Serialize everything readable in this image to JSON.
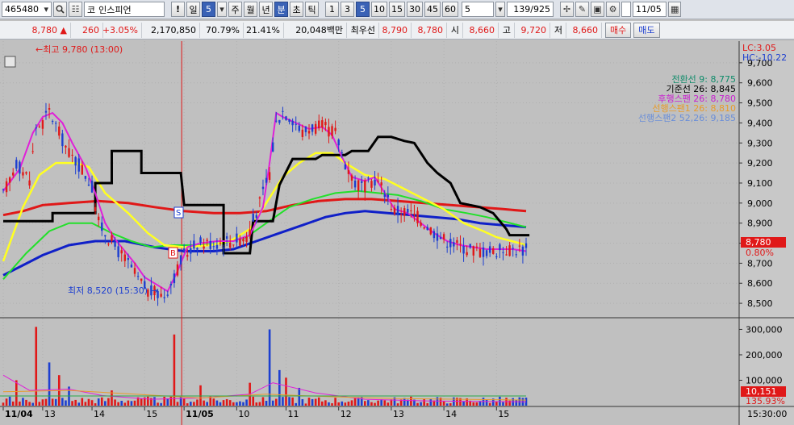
{
  "toolbar": {
    "code": "465480",
    "market_tag": "코",
    "stock_name": "인스피언",
    "period_buttons": [
      "일",
      "5",
      "주",
      "월",
      "년",
      "분",
      "초",
      "틱"
    ],
    "selected_period": "분",
    "minute_buttons": [
      "1",
      "3",
      "5",
      "10",
      "15",
      "30",
      "45",
      "60"
    ],
    "selected_minute": "5",
    "interval_value": "5",
    "count_display": "139/925",
    "date_value": "11/05"
  },
  "quote": {
    "price": "8,780",
    "change_arrow": "▲",
    "change": "260",
    "change_pct": "+3.05%",
    "volume": "2,170,850",
    "ratio1": "70.79%",
    "ratio2": "21.41%",
    "amount": "20,048백만",
    "best_label": "최우선",
    "best_ask": "8,790",
    "best_bid": "8,780",
    "open_label": "시",
    "open": "8,660",
    "high_label": "고",
    "high": "9,720",
    "low_label": "저",
    "low": "8,660",
    "buy_button": "매수",
    "sell_button": "매도"
  },
  "chart_labels": {
    "lc": "LC:3.05",
    "hc": "HC:-10.22",
    "high_note": "←최고 9,780 (13:00)",
    "low_note": "최저 8,520 (15:30) →",
    "signal_s": "S",
    "signal_b": "B",
    "current_price_tag": "8,780",
    "current_pct_tag": "0.80%",
    "volume_tag": "10,151",
    "volume_pct_tag": "135.93%",
    "time_tag": "15:30:00"
  },
  "colors": {
    "up": "#e01818",
    "down": "#1d3fd0",
    "background": "#c0c0c0"
  },
  "chart_data": [
    {
      "type": "line",
      "title": "",
      "y_ticks": [
        8500,
        8600,
        8700,
        8800,
        8900,
        9000,
        9100,
        9200,
        9300,
        9400,
        9500,
        9600,
        9700
      ],
      "ylim": [
        8440,
        9800
      ],
      "x_tick_labels": [
        "11/04",
        "13",
        "14",
        "15",
        "11/05",
        "10",
        "11",
        "12",
        "13",
        "14",
        "15"
      ],
      "x_tick_bar_index": [
        0,
        12,
        27,
        43,
        55,
        71,
        86,
        102,
        118,
        134,
        150
      ],
      "n_bars": 160,
      "series": [
        {
          "name": "전환선 9: 8,775",
          "color": "#0f8c6a"
        },
        {
          "name": "기준선 26: 8,845",
          "color": "#000000"
        },
        {
          "name": "후행스팬 26: 8,780",
          "color": "#c81ecf"
        },
        {
          "name": "선행스팬1 26: 8,810",
          "color": "#e89b2a"
        },
        {
          "name": "선행스팬2 52,26: 9,185",
          "color": "#6a8ed8"
        }
      ],
      "anchors": {
        "price": [
          [
            0,
            9040
          ],
          [
            4,
            9200
          ],
          [
            8,
            9120
          ],
          [
            10,
            9380
          ],
          [
            12,
            9400
          ],
          [
            14,
            9460
          ],
          [
            17,
            9350
          ],
          [
            20,
            9250
          ],
          [
            24,
            9170
          ],
          [
            27,
            9080
          ],
          [
            29,
            8900
          ],
          [
            32,
            8830
          ],
          [
            35,
            8760
          ],
          [
            38,
            8700
          ],
          [
            41,
            8620
          ],
          [
            44,
            8560
          ],
          [
            49,
            8540
          ],
          [
            51,
            8600
          ],
          [
            55,
            8740
          ],
          [
            59,
            8800
          ],
          [
            64,
            8800
          ],
          [
            69,
            8810
          ],
          [
            74,
            8830
          ],
          [
            78,
            9000
          ],
          [
            81,
            9150
          ],
          [
            83,
            9400
          ],
          [
            85,
            9460
          ],
          [
            88,
            9420
          ],
          [
            91,
            9350
          ],
          [
            94,
            9380
          ],
          [
            97,
            9380
          ],
          [
            101,
            9350
          ],
          [
            104,
            9200
          ],
          [
            107,
            9100
          ],
          [
            110,
            9080
          ],
          [
            113,
            9120
          ],
          [
            116,
            9060
          ],
          [
            119,
            8960
          ],
          [
            122,
            8960
          ],
          [
            126,
            8930
          ],
          [
            130,
            8870
          ],
          [
            134,
            8820
          ],
          [
            138,
            8790
          ],
          [
            142,
            8770
          ],
          [
            146,
            8760
          ],
          [
            150,
            8760
          ],
          [
            154,
            8770
          ],
          [
            159,
            8770
          ]
        ],
        "black": [
          [
            0,
            8910
          ],
          [
            15,
            8910
          ],
          [
            15,
            8950
          ],
          [
            28,
            8950
          ],
          [
            28,
            9100
          ],
          [
            33,
            9100
          ],
          [
            33,
            9260
          ],
          [
            42,
            9260
          ],
          [
            42,
            9150
          ],
          [
            54,
            9150
          ],
          [
            55,
            8990
          ],
          [
            67,
            8990
          ],
          [
            67,
            8750
          ],
          [
            75,
            8750
          ],
          [
            76,
            8910
          ],
          [
            82,
            8910
          ],
          [
            84,
            9090
          ],
          [
            88,
            9220
          ],
          [
            95,
            9220
          ],
          [
            97,
            9240
          ],
          [
            104,
            9240
          ],
          [
            106,
            9260
          ],
          [
            111,
            9260
          ],
          [
            114,
            9330
          ],
          [
            118,
            9330
          ],
          [
            122,
            9310
          ],
          [
            125,
            9300
          ],
          [
            129,
            9200
          ],
          [
            132,
            9150
          ],
          [
            136,
            9100
          ],
          [
            139,
            9000
          ],
          [
            145,
            8980
          ],
          [
            149,
            8950
          ],
          [
            153,
            8870
          ],
          [
            154,
            8840
          ],
          [
            160,
            8840
          ]
        ],
        "yellow": [
          [
            0,
            8710
          ],
          [
            6,
            8980
          ],
          [
            11,
            9140
          ],
          [
            16,
            9200
          ],
          [
            22,
            9200
          ],
          [
            26,
            9180
          ],
          [
            31,
            9050
          ],
          [
            38,
            8950
          ],
          [
            44,
            8850
          ],
          [
            49,
            8790
          ],
          [
            55,
            8780
          ],
          [
            63,
            8790
          ],
          [
            69,
            8810
          ],
          [
            75,
            8870
          ],
          [
            80,
            9000
          ],
          [
            85,
            9130
          ],
          [
            90,
            9200
          ],
          [
            95,
            9250
          ],
          [
            100,
            9250
          ],
          [
            104,
            9200
          ],
          [
            110,
            9140
          ],
          [
            116,
            9120
          ],
          [
            122,
            9070
          ],
          [
            128,
            9020
          ],
          [
            134,
            8970
          ],
          [
            140,
            8900
          ],
          [
            146,
            8860
          ],
          [
            150,
            8830
          ],
          [
            157,
            8800
          ],
          [
            159,
            8790
          ]
        ],
        "lime": [
          [
            0,
            8620
          ],
          [
            7,
            8750
          ],
          [
            14,
            8860
          ],
          [
            20,
            8900
          ],
          [
            27,
            8900
          ],
          [
            33,
            8850
          ],
          [
            39,
            8810
          ],
          [
            45,
            8780
          ],
          [
            51,
            8790
          ],
          [
            60,
            8790
          ],
          [
            67,
            8800
          ],
          [
            74,
            8830
          ],
          [
            80,
            8900
          ],
          [
            87,
            8980
          ],
          [
            94,
            9020
          ],
          [
            101,
            9050
          ],
          [
            108,
            9060
          ],
          [
            114,
            9050
          ],
          [
            120,
            9040
          ],
          [
            127,
            9010
          ],
          [
            134,
            8970
          ],
          [
            141,
            8950
          ],
          [
            147,
            8930
          ],
          [
            159,
            8880
          ]
        ],
        "red": [
          [
            0,
            8940
          ],
          [
            6,
            8960
          ],
          [
            12,
            8990
          ],
          [
            20,
            9000
          ],
          [
            29,
            9010
          ],
          [
            38,
            9000
          ],
          [
            46,
            8980
          ],
          [
            55,
            8960
          ],
          [
            64,
            8950
          ],
          [
            72,
            8950
          ],
          [
            80,
            8960
          ],
          [
            88,
            8990
          ],
          [
            96,
            9010
          ],
          [
            104,
            9020
          ],
          [
            112,
            9020
          ],
          [
            120,
            9010
          ],
          [
            128,
            9000
          ],
          [
            136,
            8990
          ],
          [
            144,
            8980
          ],
          [
            152,
            8970
          ],
          [
            159,
            8960
          ]
        ],
        "navy": [
          [
            0,
            8640
          ],
          [
            6,
            8690
          ],
          [
            12,
            8740
          ],
          [
            20,
            8790
          ],
          [
            28,
            8810
          ],
          [
            37,
            8810
          ],
          [
            46,
            8780
          ],
          [
            55,
            8760
          ],
          [
            64,
            8760
          ],
          [
            70,
            8770
          ],
          [
            77,
            8810
          ],
          [
            84,
            8850
          ],
          [
            91,
            8890
          ],
          [
            98,
            8930
          ],
          [
            104,
            8950
          ],
          [
            110,
            8960
          ],
          [
            117,
            8950
          ],
          [
            124,
            8940
          ],
          [
            131,
            8930
          ],
          [
            138,
            8920
          ],
          [
            145,
            8900
          ],
          [
            152,
            8890
          ],
          [
            159,
            8880
          ]
        ],
        "magenta": [
          [
            0,
            9060
          ],
          [
            5,
            9170
          ],
          [
            9,
            9350
          ],
          [
            12,
            9430
          ],
          [
            15,
            9450
          ],
          [
            18,
            9400
          ],
          [
            21,
            9300
          ],
          [
            25,
            9180
          ],
          [
            28,
            9050
          ],
          [
            31,
            8900
          ],
          [
            34,
            8820
          ],
          [
            37,
            8760
          ],
          [
            40,
            8700
          ],
          [
            43,
            8630
          ],
          [
            47,
            8590
          ],
          [
            50,
            8560
          ],
          [
            53,
            8660
          ],
          [
            56,
            8780
          ],
          [
            60,
            8800
          ],
          [
            65,
            8810
          ],
          [
            70,
            8810
          ],
          [
            75,
            8840
          ],
          [
            79,
            8980
          ],
          [
            81,
            9200
          ],
          [
            83,
            9450
          ],
          [
            85,
            9430
          ],
          [
            89,
            9400
          ],
          [
            93,
            9370
          ],
          [
            97,
            9380
          ],
          [
            100,
            9340
          ],
          [
            103,
            9230
          ],
          [
            106,
            9130
          ],
          [
            110,
            9110
          ],
          [
            113,
            9130
          ],
          [
            116,
            9050
          ],
          [
            119,
            8970
          ],
          [
            123,
            8950
          ],
          [
            127,
            8900
          ],
          [
            131,
            8850
          ],
          [
            135,
            8810
          ],
          [
            139,
            8790
          ],
          [
            143,
            8780
          ],
          [
            147,
            8770
          ],
          [
            151,
            8770
          ],
          [
            155,
            8770
          ],
          [
            159,
            8760
          ]
        ]
      }
    },
    {
      "type": "bar",
      "title": "",
      "y_ticks": [
        100000,
        200000,
        300000
      ],
      "y_tick_labels": [
        "100,000",
        "200,000",
        "300,000"
      ],
      "ylim": [
        0,
        330000
      ],
      "spikes": [
        [
          4,
          100000
        ],
        [
          10,
          310000
        ],
        [
          14,
          170000
        ],
        [
          17,
          120000
        ],
        [
          20,
          75000
        ],
        [
          33,
          60000
        ],
        [
          52,
          280000
        ],
        [
          60,
          80000
        ],
        [
          75,
          90000
        ],
        [
          81,
          300000
        ],
        [
          84,
          140000
        ],
        [
          86,
          110000
        ],
        [
          90,
          70000
        ]
      ],
      "base_volume": 20000
    }
  ]
}
